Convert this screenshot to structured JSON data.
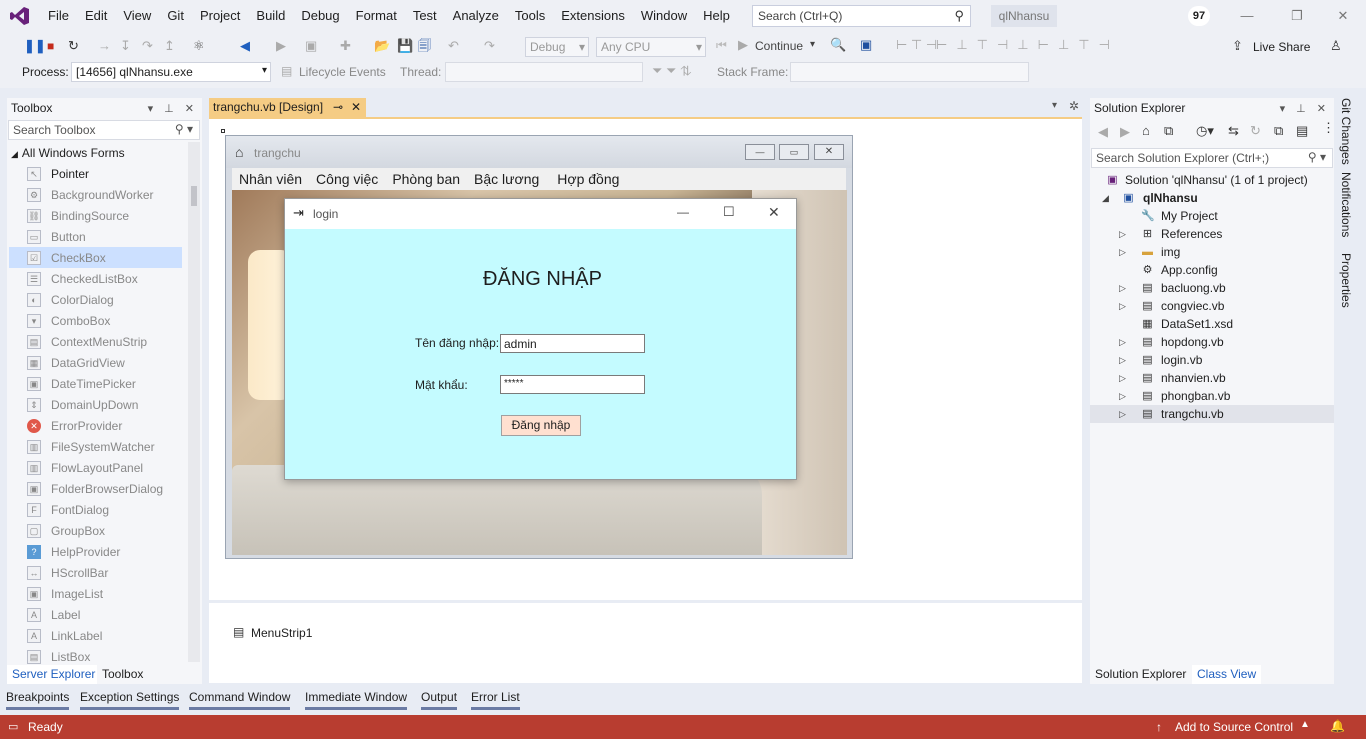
{
  "menu": {
    "items": [
      "File",
      "Edit",
      "View",
      "Git",
      "Project",
      "Build",
      "Debug",
      "Format",
      "Test",
      "Analyze",
      "Tools",
      "Extensions",
      "Window",
      "Help"
    ],
    "search_placeholder": "Search (Ctrl+Q)",
    "solution_badge": "qlNhansu",
    "notification_count": "97"
  },
  "toolbar": {
    "config": "Debug",
    "platform": "Any CPU",
    "continue_label": "Continue",
    "live_share": "Live Share",
    "process_label": "Process:",
    "process_value": "[14656] qlNhansu.exe",
    "lifecycle_label": "Lifecycle Events",
    "thread_label": "Thread:",
    "stack_label": "Stack Frame:"
  },
  "toolbox": {
    "title": "Toolbox",
    "search_placeholder": "Search Toolbox",
    "group": "All Windows Forms",
    "items": [
      "Pointer",
      "BackgroundWorker",
      "BindingSource",
      "Button",
      "CheckBox",
      "CheckedListBox",
      "ColorDialog",
      "ComboBox",
      "ContextMenuStrip",
      "DataGridView",
      "DateTimePicker",
      "DomainUpDown",
      "ErrorProvider",
      "FileSystemWatcher",
      "FlowLayoutPanel",
      "FolderBrowserDialog",
      "FontDialog",
      "GroupBox",
      "HelpProvider",
      "HScrollBar",
      "ImageList",
      "Label",
      "LinkLabel",
      "ListBox"
    ],
    "bottom_tabs": [
      "Server Explorer",
      "Toolbox"
    ]
  },
  "document": {
    "tab_label": "trangchu.vb [Design]",
    "tray_item": "MenuStrip1"
  },
  "trangchu": {
    "title": "trangchu",
    "menu": [
      "Nhân viên",
      "Công việc",
      "Phòng ban",
      "Bậc lương",
      "Hợp đồng"
    ]
  },
  "login": {
    "title": "login",
    "heading": "ĐĂNG NHẬP",
    "username_label": "Tên đăng nhập:",
    "username_value": "admin",
    "password_label": "Mật khẩu:",
    "password_value": "*****",
    "submit_label": "Đăng nhập"
  },
  "solution_explorer": {
    "title": "Solution Explorer",
    "search_placeholder": "Search Solution Explorer (Ctrl+;)",
    "solution": "Solution 'qlNhansu' (1 of 1 project)",
    "project": "qlNhansu",
    "items": [
      "My Project",
      "References",
      "img",
      "App.config",
      "bacluong.vb",
      "congviec.vb",
      "DataSet1.xsd",
      "hopdong.vb",
      "login.vb",
      "nhanvien.vb",
      "phongban.vb",
      "trangchu.vb"
    ],
    "bottom_tabs": [
      "Solution Explorer",
      "Class View"
    ]
  },
  "side_tabs": [
    "Git Changes",
    "Notifications",
    "Properties"
  ],
  "tool_windows": [
    "Breakpoints",
    "Exception Settings",
    "Command Window",
    "Immediate Window",
    "Output",
    "Error List"
  ],
  "status": {
    "text": "Ready",
    "source_control": "Add to Source Control",
    "accent": "#b83d30"
  }
}
